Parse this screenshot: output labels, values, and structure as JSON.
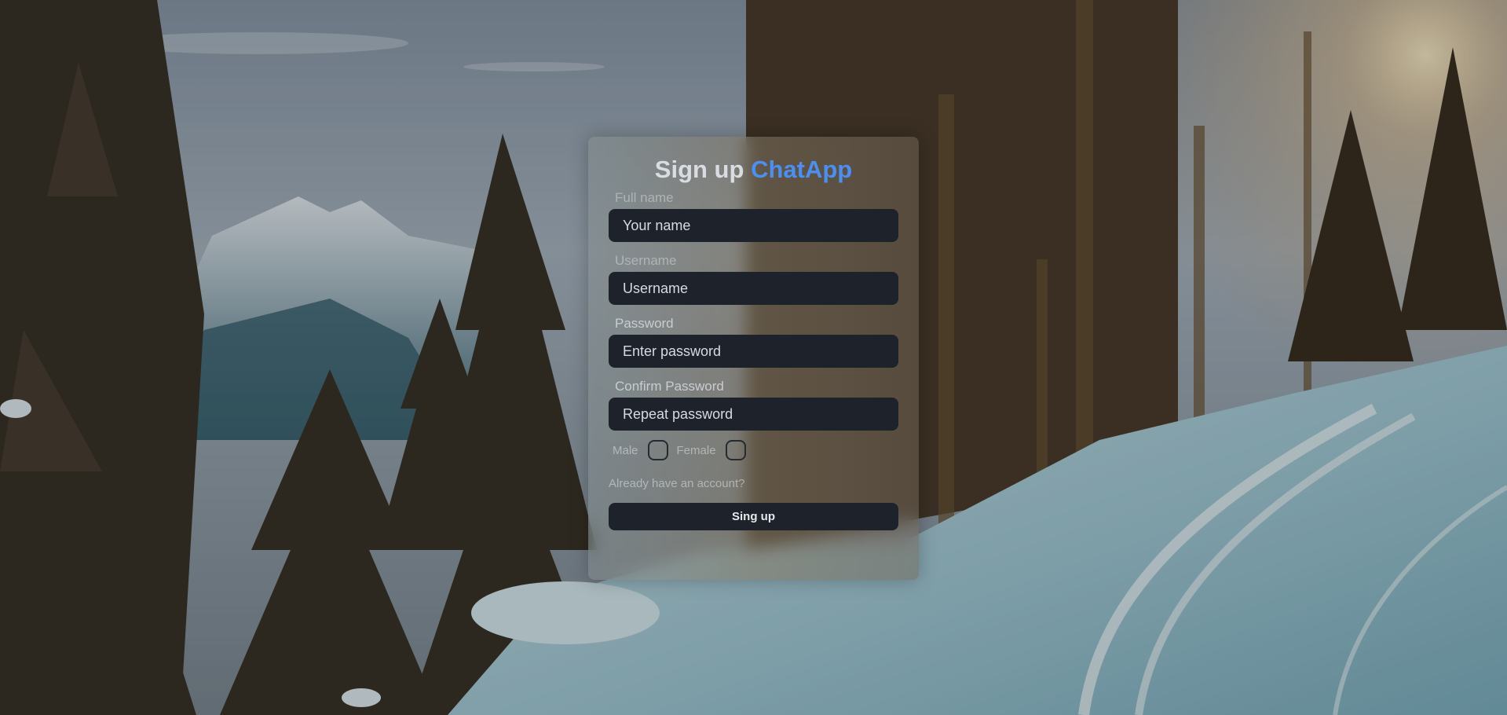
{
  "background": {
    "description_icon": "mountain-forest-snow-landscape"
  },
  "signup": {
    "title_prefix": "Sign up",
    "title_brand": "ChatApp",
    "brand_color": "#4a8ff2",
    "full_name_label": "Full name",
    "full_name_placeholder": "Your name",
    "username_label": "Username",
    "username_placeholder": "Username",
    "password_label": "Password",
    "password_placeholder": "Enter password",
    "confirm_label": "Confirm Password",
    "confirm_placeholder": "Repeat password",
    "gender_male": "Male",
    "gender_female": "Female",
    "login_link": "Already have an account?",
    "submit_label": "Sing up"
  }
}
